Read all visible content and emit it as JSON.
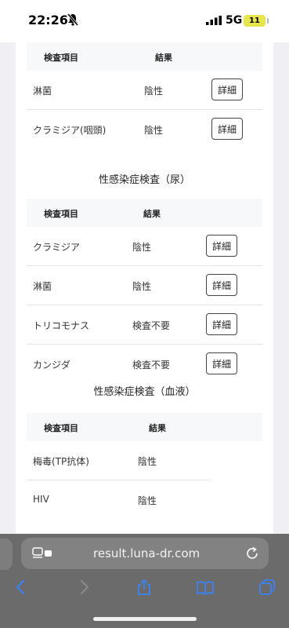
{
  "status_bar": {
    "time": "22:26",
    "network": "5G",
    "battery": "11"
  },
  "tables": {
    "headers": {
      "item": "検査項目",
      "result": "結果"
    },
    "detail_label": "詳細",
    "urine_title": "性感染症検査（尿）",
    "blood_title": "性感染症検査（血液）",
    "throat_rows": [
      {
        "item": "淋菌",
        "result": "陰性"
      },
      {
        "item": "クラミジア(咽頭)",
        "result": "陰性"
      }
    ],
    "urine_rows": [
      {
        "item": "クラミジア",
        "result": "陰性"
      },
      {
        "item": "淋菌",
        "result": "陰性"
      },
      {
        "item": "トリコモナス",
        "result": "検査不要"
      },
      {
        "item": "カンジダ",
        "result": "検査不要"
      }
    ],
    "blood_rows": [
      {
        "item": "梅毒(TP抗体)",
        "result": "陰性"
      },
      {
        "item": "HIV",
        "result": "陰性"
      }
    ]
  },
  "browser": {
    "url": "result.luna-dr.com"
  },
  "colors": {
    "accent": "#3b82f6",
    "browser_bar": "#6b6b6b"
  }
}
